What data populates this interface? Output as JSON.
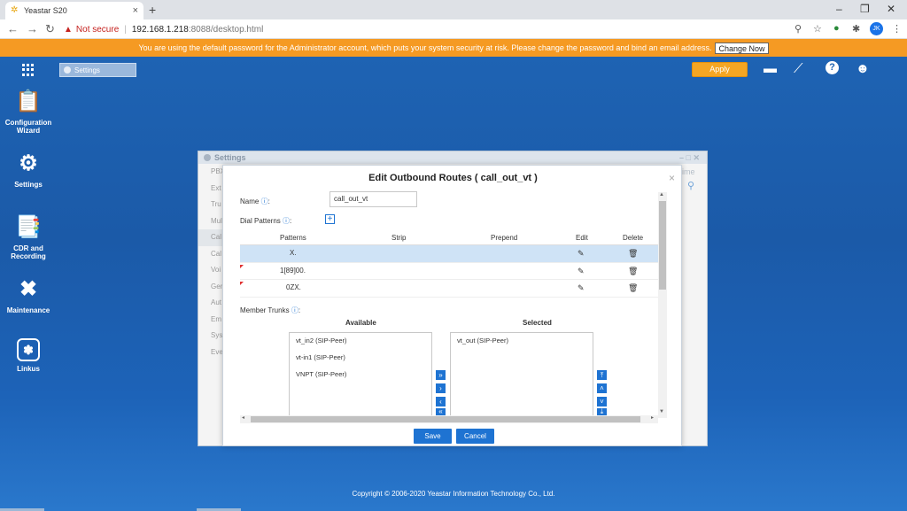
{
  "browser": {
    "tab_title": "Yeastar S20",
    "tab_close": "×",
    "new_tab": "+",
    "not_secure": "Not secure",
    "url_host": "192.168.1.218",
    "url_path": ":8088/desktop.html",
    "profile_initials": "JK"
  },
  "banner": {
    "message": "You are using the default password for the Administrator account, which puts your system security at risk. Please change the password and bind an email address.",
    "button": "Change Now"
  },
  "desktop": {
    "settings_tab": "Settings",
    "apply_label": "Apply",
    "icons": [
      {
        "label": "Configuration Wizard"
      },
      {
        "label": "Settings"
      },
      {
        "label": "CDR and Recording"
      },
      {
        "label": "Maintenance"
      },
      {
        "label": "Linkus"
      }
    ],
    "copyright": "Copyright © 2006-2020 Yeastar Information Technology Co., Ltd."
  },
  "settings_window": {
    "title": "Settings",
    "nav": [
      "PBX",
      "Ext",
      "Tru",
      "Mul",
      "Cal",
      "Cal",
      "Voi",
      "Gen",
      "Aut",
      "Em",
      "Syste",
      "Even"
    ],
    "right_text": "ime"
  },
  "dialog": {
    "title": "Edit Outbound Routes ( call_out_vt )",
    "close": "×",
    "name_label": "Name",
    "name_value": "call_out_vt",
    "dial_patterns_label": "Dial Patterns",
    "table_headers": {
      "patterns": "Patterns",
      "strip": "Strip",
      "prepend": "Prepend",
      "edit": "Edit",
      "delete": "Delete"
    },
    "patterns": [
      {
        "pattern": "X.",
        "strip": "",
        "prepend": "",
        "selected": true
      },
      {
        "pattern": "1[89]00.",
        "strip": "",
        "prepend": "",
        "selected": false
      },
      {
        "pattern": "0ZX.",
        "strip": "",
        "prepend": "",
        "selected": false
      }
    ],
    "member_trunks_label": "Member Trunks",
    "available_header": "Available",
    "selected_header": "Selected",
    "available": [
      "vt_in2 (SIP-Peer)",
      "vt-in1 (SIP-Peer)",
      "VNPT (SIP-Peer)"
    ],
    "selected": [
      "vt_out (SIP-Peer)"
    ],
    "save_label": "Save",
    "cancel_label": "Cancel"
  },
  "colors": {
    "banner": "#f59a23",
    "accent": "#1e73d2",
    "desktop": "#1e63b3"
  }
}
